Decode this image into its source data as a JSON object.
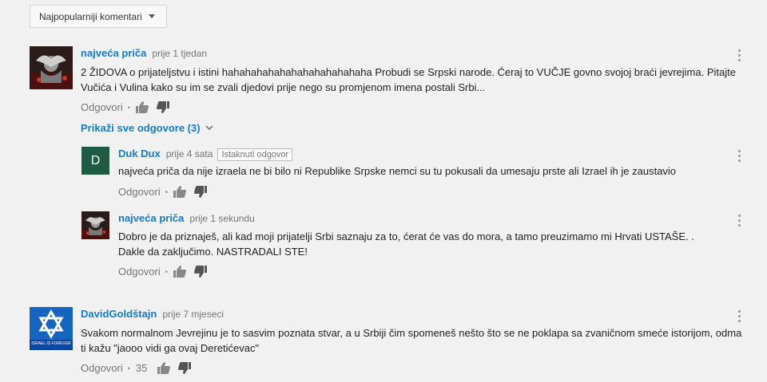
{
  "sort": {
    "label": "Najpopularniji komentari"
  },
  "reply_label": "Odgovori",
  "comments": [
    {
      "author": "najveća priča",
      "time": "prije 1 tjedan",
      "text": "2 ŽIDOVA o prijateljstvu i istini hahahahahahahahahahahahaha Probudi se Srpski narode. Ćeraj to VUČJE govno svojoj braći jevrejima. Pitajte Vučića i Vulina kako su im se zvali djedovi prije nego su promjenom imena postali Srbi..."
    },
    {
      "author": "DavidGoldštajn",
      "time": "prije 7 mjeseci",
      "text": "Svakom normalnom Jevrejinu je to sasvim poznata stvar, a u Srbiji čim spomeneš nešto što se ne poklapa sa zvaničnom smeće istorijom, odma ti kažu \"jaooo vidi ga ovaj Deretićevac\"",
      "likes": "35",
      "avatar_caption": "ISRAEL IS FOREVER"
    }
  ],
  "show_replies": "Prikaži sve odgovore (3)",
  "replies": [
    {
      "author": "Duk Dux",
      "time": "prije 4 sata",
      "badge": "Istaknuti odgovor",
      "avatar_letter": "D",
      "text": "najveća priča da nije izraela ne bi bilo ni Republike Srpske nemci su tu pokusali da umesaju prste ali Izrael ih je zaustavio"
    },
    {
      "author": "najveća priča",
      "time": "prije 1 sekundu",
      "text": "Dobro je da priznaješ, ali kad moji prijatelji Srbi saznaju za to, ćerat će vas do mora, a tamo preuzimamo mi Hrvati USTAŠE. . Dakle da zaključimo. NASTRADALI STE!"
    }
  ],
  "colors": {
    "link_blue": "#167ac6",
    "meta_gray": "#767676",
    "background": "#f1f1f1",
    "avatar_green": "#1f5a45",
    "flag_blue": "#1565c0"
  }
}
